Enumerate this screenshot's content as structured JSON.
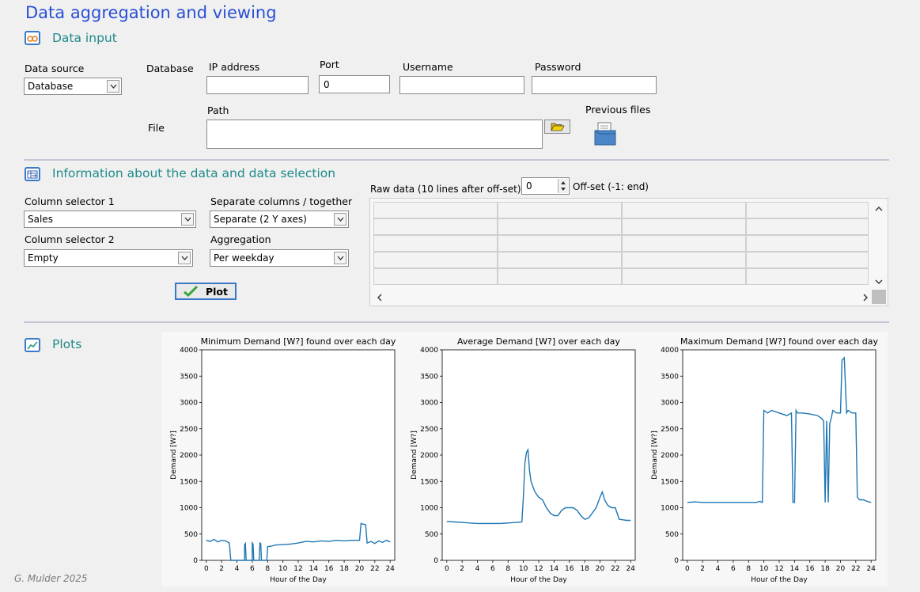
{
  "app": {
    "title": "Data aggregation and viewing",
    "footer": "G. Mulder 2025"
  },
  "data_input": {
    "section_title": "Data input",
    "data_source_label": "Data source",
    "data_source_value": "Database",
    "database_label": "Database",
    "ip_label": "IP address",
    "ip_value": "",
    "port_label": "Port",
    "port_value": "0",
    "username_label": "Username",
    "username_value": "",
    "password_label": "Password",
    "password_value": "",
    "file_label": "File",
    "path_label": "Path",
    "path_value": "",
    "previous_files_label": "Previous files"
  },
  "selection": {
    "section_title": "Information about the data and data selection",
    "col1_label": "Column selector 1",
    "col1_value": "Sales",
    "col2_label": "Column selector 2",
    "col2_value": "Empty",
    "separate_label": "Separate columns / together",
    "separate_value": "Separate (2 Y axes)",
    "aggregation_label": "Aggregation",
    "aggregation_value": "Per weekday",
    "plot_button": "Plot",
    "raw_label": "Raw data (10 lines after off-set)",
    "offset_value": "0",
    "offset_label": "Off-set (-1: end)"
  },
  "plots_section": {
    "section_title": "Plots"
  },
  "colors": {
    "title": "#2a4fd6",
    "section": "#1f8a8a",
    "line": "#1f77b4"
  },
  "chart_data": [
    {
      "type": "line",
      "title": "Minimum Demand [W?] found over each day",
      "xlabel": "Hour of the Day",
      "ylabel": "Demand [W?]",
      "xlim": [
        -0.6,
        24.6
      ],
      "ylim": [
        0,
        4000
      ],
      "xticks": [
        "0",
        "2",
        "4",
        "6",
        "8",
        "10",
        "12",
        "14",
        "16",
        "18",
        "20",
        "22",
        "24"
      ],
      "yticks": [
        "0",
        "500",
        "1000",
        "1500",
        "2000",
        "2500",
        "3000",
        "3500",
        "4000"
      ],
      "x": [
        0,
        0.5,
        1,
        1.5,
        2,
        2.5,
        3,
        3.2,
        3.5,
        4,
        4.5,
        5,
        5,
        5.1,
        5.2,
        5.3,
        5.5,
        6,
        6,
        6.1,
        6.2,
        6.3,
        6.5,
        6.9,
        7,
        7.1,
        7.2,
        7.5,
        7.9,
        8,
        8.5,
        9,
        10,
        11,
        12,
        13,
        14,
        15,
        16,
        17,
        18,
        19,
        19.5,
        20,
        20.2,
        20.4,
        20.8,
        21,
        21.5,
        22,
        22.5,
        23,
        23.5,
        24
      ],
      "y": [
        380,
        360,
        400,
        350,
        380,
        370,
        330,
        0,
        0,
        0,
        0,
        0,
        300,
        320,
        0,
        0,
        0,
        0,
        330,
        310,
        0,
        0,
        0,
        0,
        330,
        320,
        0,
        0,
        0,
        260,
        270,
        290,
        300,
        310,
        330,
        360,
        350,
        370,
        360,
        380,
        370,
        380,
        380,
        380,
        700,
        690,
        680,
        330,
        360,
        320,
        370,
        340,
        380,
        350
      ],
      "series": [
        {
          "name": "",
          "color": "#1f77b4"
        }
      ]
    },
    {
      "type": "line",
      "title": "Average Demand [W?] over each day",
      "xlabel": "Hour of the Day",
      "ylabel": "Demand [W?]",
      "xlim": [
        -0.6,
        24.6
      ],
      "ylim": [
        0,
        4000
      ],
      "xticks": [
        "0",
        "2",
        "4",
        "6",
        "8",
        "10",
        "12",
        "14",
        "16",
        "18",
        "20",
        "22",
        "24"
      ],
      "yticks": [
        "0",
        "500",
        "1000",
        "1500",
        "2000",
        "2500",
        "3000",
        "3500",
        "4000"
      ],
      "x": [
        0,
        1,
        2,
        3,
        4,
        5,
        6,
        7,
        8,
        9,
        9.8,
        10,
        10.2,
        10.4,
        10.6,
        10.8,
        11,
        11.5,
        12,
        12.5,
        13,
        13.5,
        14,
        14.5,
        15,
        15.5,
        16,
        16.5,
        17,
        17.5,
        18,
        18.5,
        19,
        19.5,
        20,
        20.3,
        20.6,
        21,
        21.5,
        22,
        22.5,
        23,
        23.5,
        24
      ],
      "y": [
        740,
        730,
        720,
        710,
        700,
        700,
        700,
        700,
        710,
        720,
        730,
        1200,
        1850,
        2050,
        2100,
        1700,
        1500,
        1300,
        1200,
        1150,
        1000,
        900,
        850,
        850,
        950,
        1000,
        1000,
        1000,
        950,
        850,
        780,
        800,
        900,
        1000,
        1200,
        1300,
        1150,
        1050,
        1000,
        1000,
        780,
        770,
        760,
        760
      ],
      "series": [
        {
          "name": "",
          "color": "#1f77b4"
        }
      ]
    },
    {
      "type": "line",
      "title": "Maximum Demand [W?] found over each day",
      "xlabel": "Hour of the Day",
      "ylabel": "Demand [W?]",
      "xlim": [
        -0.6,
        24.6
      ],
      "ylim": [
        0,
        4000
      ],
      "xticks": [
        "0",
        "2",
        "4",
        "6",
        "8",
        "10",
        "12",
        "14",
        "16",
        "18",
        "20",
        "22",
        "24"
      ],
      "yticks": [
        "0",
        "500",
        "1000",
        "1500",
        "2000",
        "2500",
        "3000",
        "3500",
        "4000"
      ],
      "x": [
        0,
        1,
        2,
        3,
        4,
        5,
        6,
        7,
        8,
        9,
        9.5,
        9.8,
        10,
        10.5,
        11,
        12,
        13,
        13.6,
        13.8,
        14,
        14.2,
        14.4,
        15,
        16,
        17,
        17.5,
        17.8,
        18,
        18.2,
        18.4,
        18.6,
        18.8,
        19,
        19.5,
        20,
        20.2,
        20.5,
        20.8,
        21,
        21.5,
        22,
        22.2,
        22.5,
        23,
        23.5,
        24
      ],
      "y": [
        1100,
        1110,
        1100,
        1100,
        1100,
        1100,
        1100,
        1100,
        1100,
        1100,
        1120,
        1100,
        2850,
        2800,
        2850,
        2800,
        2750,
        2800,
        1100,
        1100,
        2850,
        2800,
        2800,
        2780,
        2750,
        2700,
        2650,
        1100,
        2650,
        1100,
        2600,
        2700,
        2850,
        2800,
        2800,
        3800,
        3850,
        2800,
        2850,
        2800,
        2800,
        1200,
        1150,
        1150,
        1120,
        1100
      ],
      "series": [
        {
          "name": "",
          "color": "#1f77b4"
        }
      ]
    }
  ]
}
